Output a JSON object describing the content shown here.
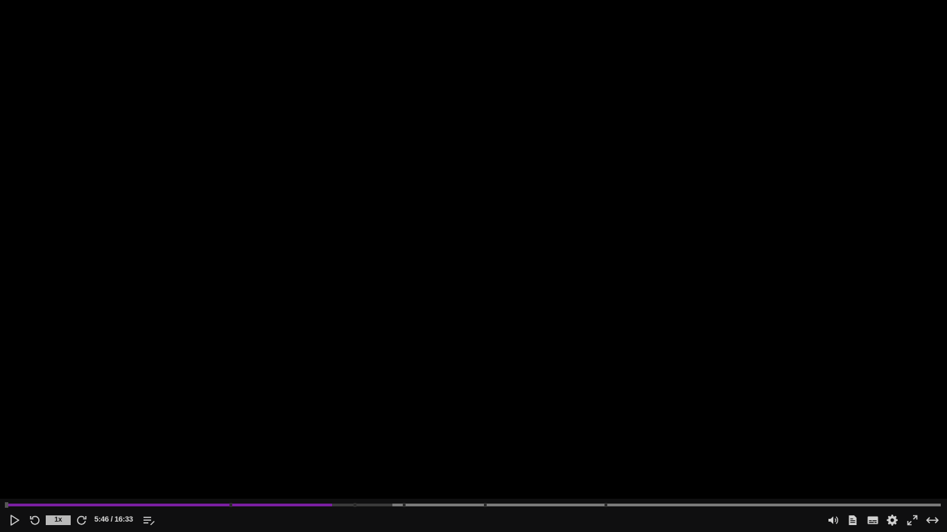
{
  "player": {
    "accent_color": "#7b1fa2",
    "state": "paused",
    "progress": {
      "played_fraction": 0.3485,
      "buffered_fraction": 0.4125,
      "chapter_fractions": [
        0.2395,
        0.3725,
        0.4255,
        0.5125,
        0.6415
      ]
    },
    "controls": {
      "play_icon": "play-icon",
      "rewind_icon": "replay-icon",
      "speed_label": "1x",
      "forward_icon": "forward-icon",
      "time_text": "5:46 / 16:33",
      "notes_icon": "edit-notes-icon",
      "volume_icon": "volume-icon",
      "transcript_icon": "transcript-icon",
      "captions_icon": "captions-icon",
      "settings_icon": "gear-icon",
      "fullscreen_icon": "fullscreen-icon",
      "theater_icon": "expand-horizontal-icon"
    }
  }
}
